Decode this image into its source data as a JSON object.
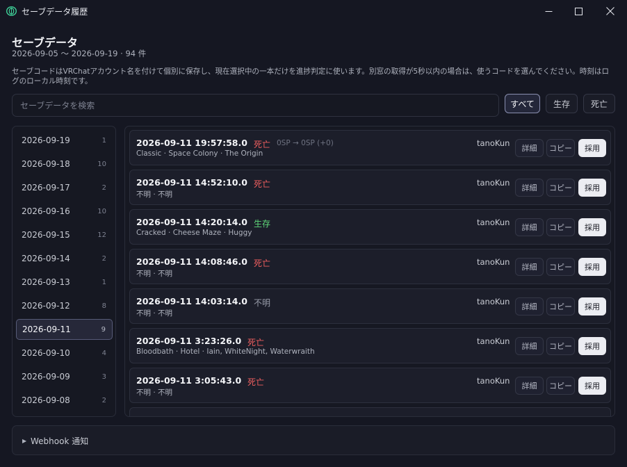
{
  "window": {
    "title": "セーブデータ履歴"
  },
  "header": {
    "title": "セーブデータ",
    "date_range": "2026-09-05 〜 2026-09-19 · 94 件",
    "description": "セーブコードはVRChatアカウント名を付けて個別に保存し、現在選択中の一本だけを進捗判定に使います。別窓の取得が5秒以内の場合は、使うコードを選んでください。時刻はログのローカル時刻です。"
  },
  "search": {
    "placeholder": "セーブデータを検索",
    "value": ""
  },
  "filters": {
    "all": "すべて",
    "alive": "生存",
    "dead": "死亡",
    "selected": "all"
  },
  "dates": [
    {
      "date": "2026-09-19",
      "count": "1"
    },
    {
      "date": "2026-09-18",
      "count": "10"
    },
    {
      "date": "2026-09-17",
      "count": "2"
    },
    {
      "date": "2026-09-16",
      "count": "10"
    },
    {
      "date": "2026-09-15",
      "count": "12"
    },
    {
      "date": "2026-09-14",
      "count": "2"
    },
    {
      "date": "2026-09-13",
      "count": "1"
    },
    {
      "date": "2026-09-12",
      "count": "8"
    },
    {
      "date": "2026-09-11",
      "count": "9"
    },
    {
      "date": "2026-09-10",
      "count": "4"
    },
    {
      "date": "2026-09-09",
      "count": "3"
    },
    {
      "date": "2026-09-08",
      "count": "2"
    }
  ],
  "selected_date": "2026-09-11",
  "entries": [
    {
      "time": "2026-09-11 19:57:58.0",
      "status": "死亡",
      "status_kind": "dead",
      "sp": "0SP → 0SP (+0)",
      "details": "Classic · Space Colony · The Origin",
      "user": "tanoKun"
    },
    {
      "time": "2026-09-11 14:52:10.0",
      "status": "死亡",
      "status_kind": "dead",
      "sp": "",
      "details": "不明 · 不明",
      "user": "tanoKun"
    },
    {
      "time": "2026-09-11 14:20:14.0",
      "status": "生存",
      "status_kind": "alive",
      "sp": "",
      "details": "Cracked · Cheese Maze · Huggy",
      "user": "tanoKun"
    },
    {
      "time": "2026-09-11 14:08:46.0",
      "status": "死亡",
      "status_kind": "dead",
      "sp": "",
      "details": "不明 · 不明",
      "user": "tanoKun"
    },
    {
      "time": "2026-09-11 14:03:14.0",
      "status": "不明",
      "status_kind": "unknown",
      "sp": "",
      "details": "不明 · 不明",
      "user": "tanoKun"
    },
    {
      "time": "2026-09-11 3:23:26.0",
      "status": "死亡",
      "status_kind": "dead",
      "sp": "",
      "details": "Bloodbath · Hotel · Iain, WhiteNight, Waterwraith",
      "user": "tanoKun"
    },
    {
      "time": "2026-09-11 3:05:43.0",
      "status": "死亡",
      "status_kind": "dead",
      "sp": "",
      "details": "不明 · 不明",
      "user": "tanoKun"
    }
  ],
  "entry_buttons": {
    "detail": "詳細",
    "copy": "コピー",
    "adopt": "採用"
  },
  "webhook": {
    "label": "Webhook 通知"
  }
}
